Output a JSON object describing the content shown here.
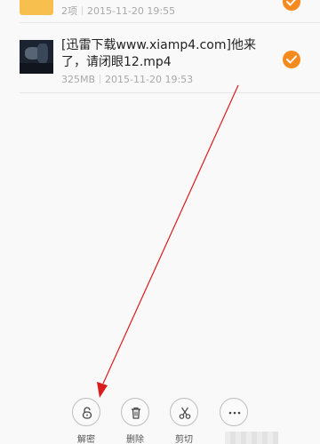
{
  "files": [
    {
      "title": "",
      "count": "2项",
      "date": "2015-11-20 19:55",
      "checked": true,
      "icon": "folder-icon"
    },
    {
      "title": "[迅雷下载www.xiamp4.com]他来了，请闭眼12.mp4",
      "size": "325MB",
      "date": "2015-11-20 19:53",
      "checked": true,
      "icon": "video-thumbnail"
    }
  ],
  "toolbar": {
    "decrypt_label": "解密",
    "delete_label": "删除",
    "cut_label": "剪切",
    "more_label": ""
  },
  "colors": {
    "accent": "#f58a1f",
    "folder": "#f7c04e",
    "background": "#f9f9f9",
    "annotation": "#d91c1c"
  }
}
